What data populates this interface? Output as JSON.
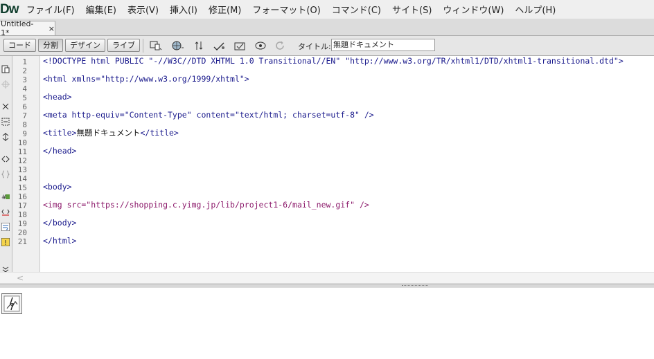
{
  "app": {
    "logo": "Dw"
  },
  "menu": [
    "ファイル(F)",
    "編集(E)",
    "表示(V)",
    "挿入(I)",
    "修正(M)",
    "フォーマット(O)",
    "コマンド(C)",
    "サイト(S)",
    "ウィンドウ(W)",
    "ヘルプ(H)"
  ],
  "document_tab": {
    "name": "Untitled-1*",
    "close": "×"
  },
  "toolbar": {
    "code_label": "コード",
    "split_label": "分割",
    "design_label": "デザイン",
    "live_label": "ライブ",
    "title_label": "タイトル:",
    "title_value": "無題ドキュメント"
  },
  "editor": {
    "line_numbers": [
      "1",
      "2",
      "3",
      "4",
      "5",
      "6",
      "7",
      "8",
      "9",
      "10",
      "11",
      "12",
      "13",
      "14",
      "15",
      "16",
      "17",
      "18",
      "19",
      "20",
      "21"
    ],
    "lines": {
      "l1": "<!DOCTYPE html PUBLIC \"-//W3C//DTD XHTML 1.0 Transitional//EN\" \"http://www.w3.org/TR/xhtml1/DTD/xhtml1-transitional.dtd\">",
      "l3": "<html xmlns=\"http://www.w3.org/1999/xhtml\">",
      "l5": "<head>",
      "l7": "<meta http-equiv=\"Content-Type\" content=\"text/html; charset=utf-8\" />",
      "l9_open": "<title>",
      "l9_text": "無題ドキュメント",
      "l9_close": "</title>",
      "l11": "</head>",
      "l15": "<body>",
      "l17": "<img src=\"https://shopping.c.yimg.jp/lib/project1-6/mail_new.gif\" />",
      "l19": "</body>",
      "l21": "</html>"
    }
  },
  "scroll": {
    "left_arrow": "<"
  }
}
